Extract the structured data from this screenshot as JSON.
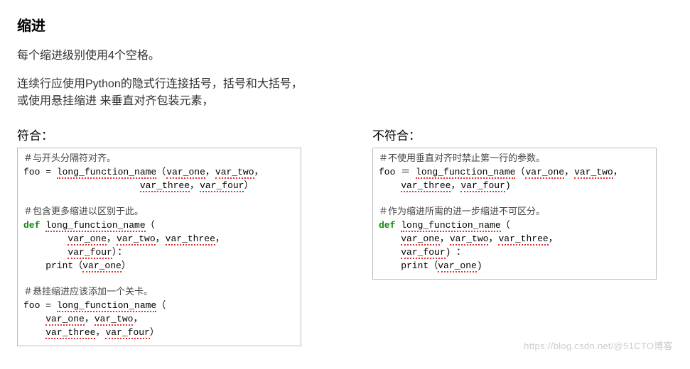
{
  "title": "缩进",
  "intro1": "每个缩进级别使用4个空格。",
  "intro2": "连续行应使用Python的隐式行连接括号，括号和大括号，\n或使用悬挂缩进 来垂直对齐包装元素，",
  "left": {
    "heading": "符合：",
    "c1": "＃与开头分隔符对齐。",
    "l1a": "foo = ",
    "l1b": "long_function_name",
    "l1c": "（",
    "l1d": "var_one",
    "l1e": "，",
    "l1f": "var_two",
    "l1g": "，",
    "l2a": "                     ",
    "l2b": "var_three",
    "l2c": "，",
    "l2d": "var_four",
    "l2e": "）",
    "c2": "＃包含更多缩进以区别于此。",
    "l3a": "def",
    "l3b": " ",
    "l3c": "long_function_name",
    "l3d": "（",
    "l4a": "        ",
    "l4b": "var_one",
    "l4c": "，",
    "l4d": "var_two",
    "l4e": "，",
    "l4f": "var_three",
    "l4g": "，",
    "l5a": "        ",
    "l5b": "var_four",
    "l5c": "）：",
    "l6a": "    print（",
    "l6b": "var_one",
    "l6c": "）",
    "c3": "＃悬挂缩进应该添加一个关卡。",
    "l7a": "foo = ",
    "l7b": "long_function_name",
    "l7c": "（",
    "l8a": "    ",
    "l8b": "var_one",
    "l8c": "，",
    "l8d": "var_two",
    "l8e": "，",
    "l9a": "    ",
    "l9b": "var_three",
    "l9c": "，",
    "l9d": "var_four",
    "l9e": "）"
  },
  "right": {
    "heading": "不符合：",
    "c1": "＃不使用垂直对齐时禁止第一行的参数。",
    "l1a": "foo ＝ ",
    "l1b": "long_function_name",
    "l1c": "（",
    "l1d": "var_one",
    "l1e": "，",
    "l1f": "var_two",
    "l1g": "，",
    "l2a": "    ",
    "l2b": "var_three",
    "l2c": "，",
    "l2d": "var_four",
    "l2e": ")",
    "c2": "＃作为缩进所需的进一步缩进不可区分。",
    "l3a": "def",
    "l3b": " ",
    "l3c": "long_function_name",
    "l3d": "（",
    "l4a": "    ",
    "l4b": "var_one",
    "l4c": "，",
    "l4d": "var_two",
    "l4e": "，",
    "l4f": "var_three",
    "l4g": "，",
    "l5a": "    ",
    "l5b": "var_four",
    "l5c": ") ：",
    "l6a": "    print（",
    "l6b": "var_one",
    "l6c": ")"
  },
  "watermark": "https://blog.csdn.net/@51CTO博客"
}
